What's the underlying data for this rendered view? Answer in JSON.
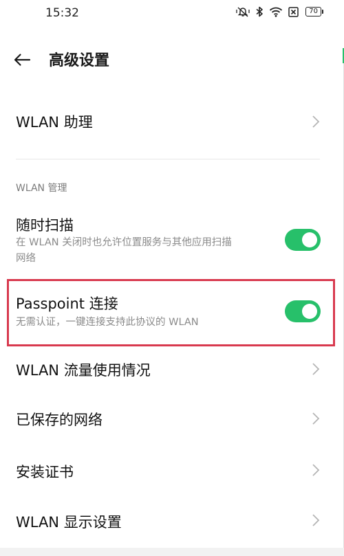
{
  "status_bar": {
    "time": "15:32",
    "battery": "70",
    "icons": [
      "vibrate-mute-icon",
      "bluetooth-icon",
      "wifi-icon",
      "sim-off-icon",
      "battery-icon"
    ]
  },
  "app_bar": {
    "title": "高级设置",
    "back_icon": "arrow-left-icon"
  },
  "items": {
    "wlan_assistant": {
      "label": "WLAN 助理"
    },
    "section_label": "WLAN 管理",
    "scan_anytime": {
      "label": "随时扫描",
      "description_line1": "在 WLAN 关闭时也允许位置服务与其他应用扫描",
      "description_line2": "网络",
      "enabled": true
    },
    "passpoint": {
      "label": "Passpoint 连接",
      "description": "无需认证，一键连接支持此协议的 WLAN",
      "enabled": true
    },
    "traffic_usage": {
      "label": "WLAN 流量使用情况"
    },
    "saved_networks": {
      "label": "已保存的网络"
    },
    "install_cert": {
      "label": "安装证书"
    },
    "display_settings": {
      "label": "WLAN 显示设置"
    }
  },
  "colors": {
    "accent": "#27c06a",
    "highlight": "#d8394e",
    "secondary_text": "#8a8a8a"
  }
}
